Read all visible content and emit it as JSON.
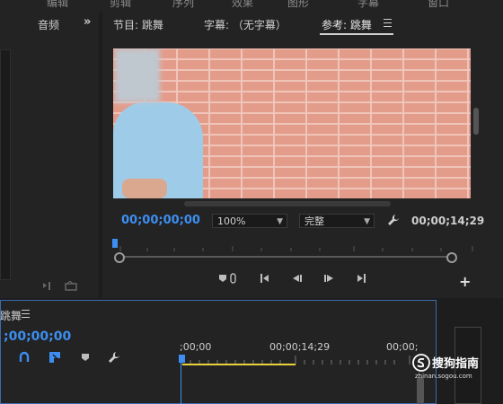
{
  "menubar": {
    "items": [
      "编辑",
      "剪辑",
      "序列",
      "效果",
      "图形",
      "字幕",
      "窗口"
    ]
  },
  "left_panel": {
    "tab_label": "音频"
  },
  "monitor": {
    "tabs": [
      {
        "label": "节目: 跳舞"
      },
      {
        "label": "字幕: （无字幕）"
      },
      {
        "label": "参考: 跳舞"
      }
    ],
    "timecode_current": "00;00;00;00",
    "zoom_select": "100%",
    "quality_select": "完整",
    "timecode_duration": "00;00;14;29"
  },
  "timeline": {
    "sequence_title": "跳舞",
    "timecode": ";00;00;00",
    "ruler_labels": [
      ";00;00",
      "00;00;14;29",
      "00;00;"
    ]
  },
  "watermark": {
    "main": "搜狗指南",
    "sub": "zhinan.sogou.com"
  },
  "colors": {
    "accent_blue": "#3d8ef0",
    "work_area_yellow": "#e8d43a",
    "panel_bg": "#232323"
  }
}
